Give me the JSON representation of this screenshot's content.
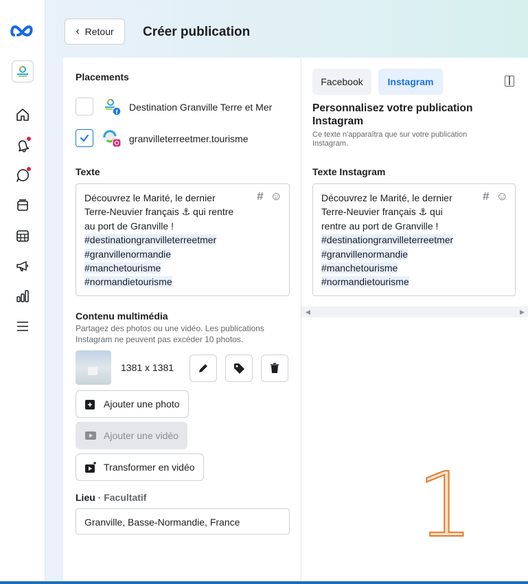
{
  "header": {
    "back_label": "Retour",
    "title": "Créer publication"
  },
  "rail": {
    "icons": [
      "meta-logo",
      "home-icon",
      "bell-icon",
      "chat-icon",
      "content-icon",
      "calendar-icon",
      "megaphone-icon",
      "insights-icon",
      "menu-icon"
    ]
  },
  "placements": {
    "heading": "Placements",
    "accounts": [
      {
        "name": "Destination Granville Terre et Mer",
        "network": "facebook",
        "checked": false
      },
      {
        "name": "granvilleterreetmer.tourisme",
        "network": "instagram",
        "checked": true
      }
    ]
  },
  "text_section": {
    "heading": "Texte",
    "lines": [
      "Découvrez le Marité, le dernier",
      "Terre-Neuvier français ⚓ qui rentre",
      "au port de Granville !",
      "#destinationgranvilleterreetmer",
      "#granvillenormandie",
      "#manchetourisme",
      "#normandietourisme"
    ]
  },
  "media": {
    "heading": "Contenu multimédia",
    "sub_line1": "Partagez des photos ou une vidéo. Les publications",
    "sub_line2": "Instagram ne peuvent pas excéder 10 photos.",
    "dimensions": "1381 x 1381",
    "add_photo": "Ajouter une photo",
    "add_video": "Ajouter une vidéo",
    "to_video": "Transformer en vidéo"
  },
  "location": {
    "heading": "Lieu",
    "optional": "· Facultatif",
    "value": "Granville, Basse-Normandie, France"
  },
  "preview": {
    "tabs": [
      "Facebook",
      "Instagram"
    ],
    "active_tab": "Instagram",
    "title_line1": "Personnalisez votre publication",
    "title_line2": "Instagram",
    "sub_line1": "Ce texte n'apparaîtra que sur votre publication",
    "sub_line2": "Instagram.",
    "text_heading": "Texte Instagram",
    "lines": [
      "Découvrez le Marité, le dernier",
      "Terre-Neuvier français ⚓ qui",
      "rentre au port de Granville !",
      "#destinationgranvilleterreetmer",
      "#granvillenormandie",
      "#manchetourisme",
      "#normandietourisme"
    ]
  },
  "annotation": "1",
  "colors": {
    "accent": "#1b74e4",
    "frame": "#1d6fb8",
    "annotation_stroke": "#e07a2e"
  }
}
